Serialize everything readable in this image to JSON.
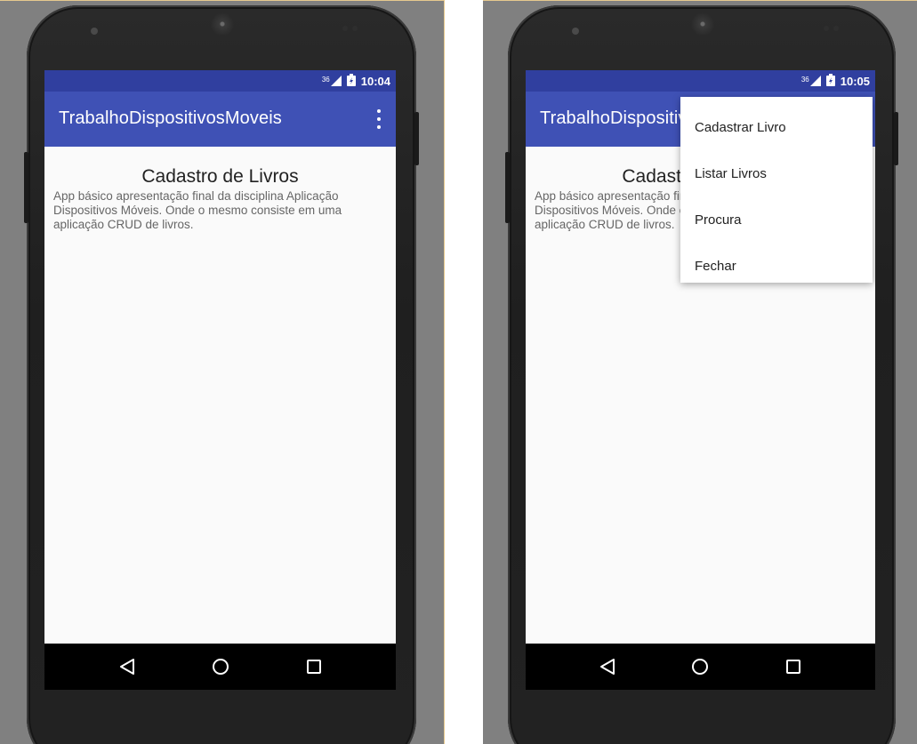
{
  "left": {
    "status": {
      "signal": "36",
      "time": "10:04"
    },
    "app_title": "TrabalhoDispositivosMoveis",
    "page_title": "Cadastro de Livros",
    "description": "App básico apresentação final da disciplina Aplicação Dispositivos Móveis. Onde o mesmo consiste em uma aplicação CRUD de livros."
  },
  "right": {
    "status": {
      "signal": "36",
      "time": "10:05"
    },
    "app_title": "TrabalhoDispositivosMoveis",
    "page_title": "Cadastro de Livros",
    "description": "App básico apresentação final da disciplina Aplicação Dispositivos Móveis. Onde o mesmo consiste em uma aplicação CRUD de livros.",
    "menu_items": [
      "Cadastrar Livro",
      "Listar Livros",
      "Procura",
      "Fechar"
    ]
  },
  "icons": {
    "status": [
      "signal-icon",
      "battery-icon"
    ],
    "nav": [
      "back-icon",
      "home-icon",
      "recents-icon"
    ],
    "appbar": "overflow-menu-icon"
  },
  "colors": {
    "status_bar": "#303f9f",
    "app_bar": "#3f51b5",
    "background": "#fafafa",
    "nav_bar": "#000000"
  }
}
